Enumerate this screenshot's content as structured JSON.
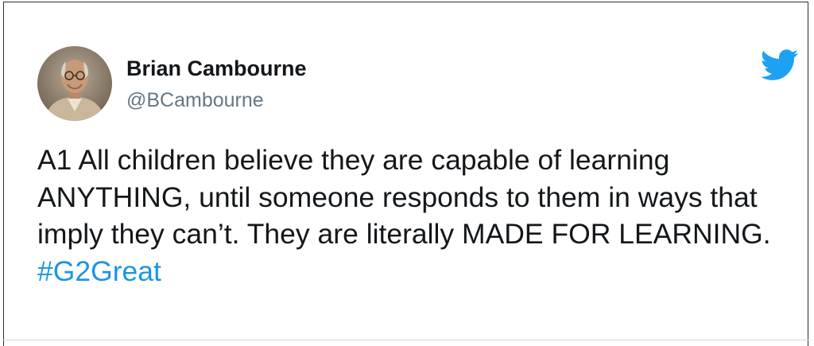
{
  "tweet": {
    "author": {
      "name": "Brian Cambourne",
      "handle": "@BCambourne",
      "avatar_icon": "person-avatar-icon"
    },
    "platform_icon": "twitter-bird-icon",
    "text": "A1 All children believe they are capable of learning ANYTHING, until someone responds to them in ways that imply they can’t. They are literally MADE FOR LEARNING.",
    "hashtag": "#G2Great"
  },
  "colors": {
    "text": "#14171a",
    "handle": "#657786",
    "link": "#1b95e0",
    "twitter_blue": "#1da1f2"
  }
}
